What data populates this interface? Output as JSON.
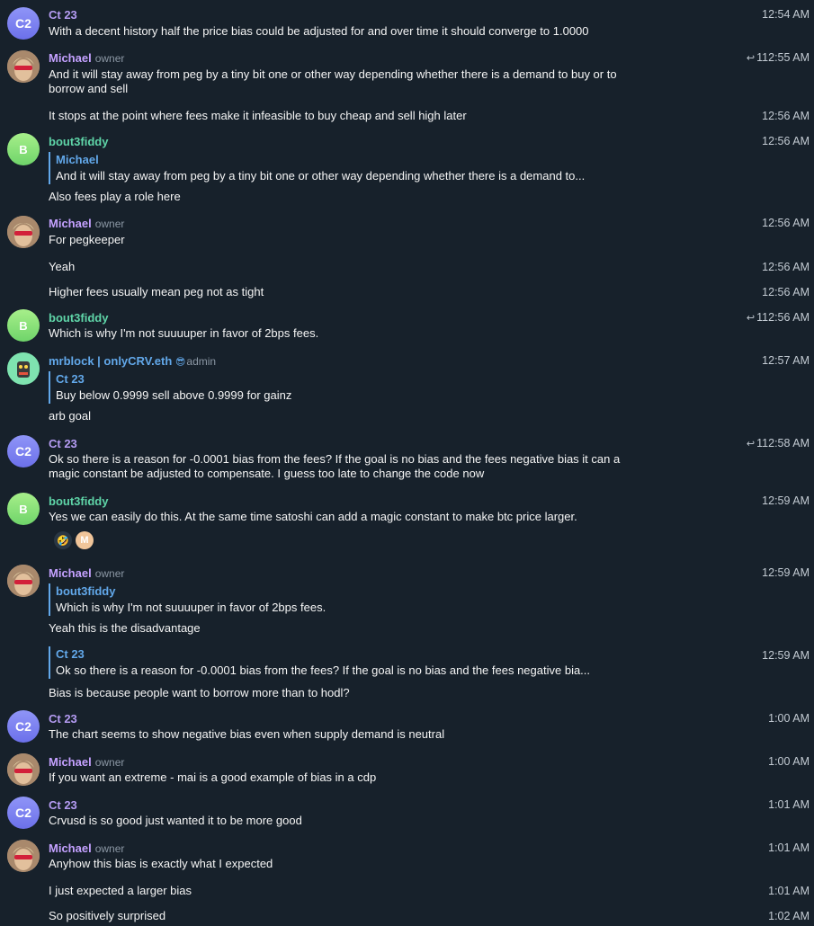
{
  "messages": {
    "m0": {
      "avatar": "C2",
      "name": "Ct 23",
      "time": "12:54 AM",
      "text": "With a decent history half the price bias could be adjusted for and over time it should converge to 1.0000"
    },
    "m1": {
      "name": "Michael",
      "role": "owner",
      "reply_count": "1",
      "time": "12:55 AM",
      "text": "And it will stay away from peg by a tiny bit one or other way depending whether there is a demand to buy or to borrow and sell"
    },
    "m2": {
      "time": "12:56 AM",
      "text": "It stops at the point where fees make it infeasible to buy cheap and sell high later"
    },
    "m3": {
      "avatar": "B",
      "name": "bout3fiddy",
      "time": "12:56 AM",
      "quote_name": "Michael",
      "quote_text": "And it will stay away from peg by a tiny bit one or other way depending whether there is a demand to...",
      "text": "Also fees play a role here"
    },
    "m4": {
      "name": "Michael",
      "role": "owner",
      "time": "12:56 AM",
      "text": "For pegkeeper"
    },
    "m5": {
      "time": "12:56 AM",
      "text": "Yeah"
    },
    "m6": {
      "time": "12:56 AM",
      "text": "Higher fees usually mean peg not as tight"
    },
    "m7": {
      "avatar": "B",
      "name": "bout3fiddy",
      "reply_count": "1",
      "time": "12:56 AM",
      "text": "Which is why I'm not suuuuper in favor of 2bps fees."
    },
    "m8": {
      "name": "mrblock | onlyCRV.eth",
      "role": "admin",
      "time": "12:57 AM",
      "quote_name": "Ct 23",
      "quote_text": "Buy below 0.9999 sell above 0.9999 for gainz",
      "text": "arb goal"
    },
    "m9": {
      "avatar": "C2",
      "name": "Ct 23",
      "reply_count": "1",
      "time": "12:58 AM",
      "text": "Ok so there is a reason for -0.0001 bias from the fees? If the goal is no bias and the fees negative bias it can a magic constant be adjusted to compensate. I guess too late to change the code now"
    },
    "m10": {
      "avatar": "B",
      "name": "bout3fiddy",
      "time": "12:59 AM",
      "text": "Yes we can easily do this. At the same time satoshi can add a magic constant to make btc price larger.",
      "reaction_avatar": "M"
    },
    "m11": {
      "name": "Michael",
      "role": "owner",
      "time": "12:59 AM",
      "quote_name": "bout3fiddy",
      "quote_text": "Which is why I'm not suuuuper in favor of 2bps fees.",
      "text": "Yeah this is the disadvantage"
    },
    "m12": {
      "time": "12:59 AM",
      "quote_name": "Ct 23",
      "quote_text": "Ok so there is a reason for -0.0001 bias from the fees? If the goal is no bias and the fees negative bia...",
      "text": "Bias is because people want to borrow more than to hodl?"
    },
    "m13": {
      "avatar": "C2",
      "name": "Ct 23",
      "time": "1:00 AM",
      "text": "The chart seems to show negative bias even when supply demand is neutral"
    },
    "m14": {
      "name": "Michael",
      "role": "owner",
      "time": "1:00 AM",
      "text": "If you want an extreme - mai is a good example of bias in a cdp"
    },
    "m15": {
      "avatar": "C2",
      "name": "Ct 23",
      "time": "1:01 AM",
      "text": "Crvusd is so good just wanted it to be more good"
    },
    "m16": {
      "name": "Michael",
      "role": "owner",
      "time": "1:01 AM",
      "text": "Anyhow this bias is exactly what I expected"
    },
    "m17": {
      "time": "1:01 AM",
      "text": "I just expected a larger bias"
    },
    "m18": {
      "time": "1:02 AM",
      "text": "So positively surprised"
    }
  }
}
